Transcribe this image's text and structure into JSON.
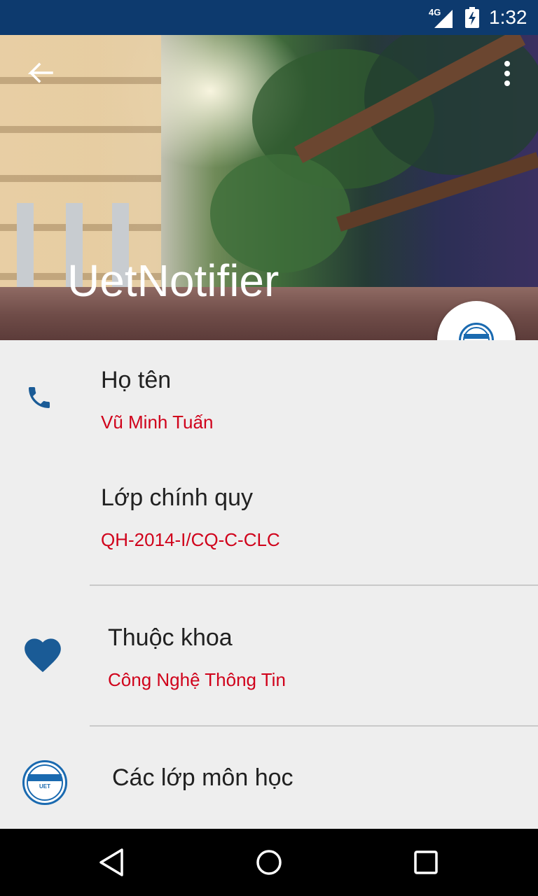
{
  "status_bar": {
    "network": "4G",
    "time": "1:32",
    "signal_icon": "cell-signal-icon",
    "battery_icon": "battery-charging-icon"
  },
  "header": {
    "title": "UetNotifier",
    "back_icon": "back-arrow-icon",
    "menu_icon": "more-vert-icon"
  },
  "fab": {
    "icon": "uet-logo-icon"
  },
  "profile": {
    "name": {
      "label": "Họ tên",
      "value": "Vũ Minh Tuấn",
      "icon": "phone-icon"
    },
    "class": {
      "label": "Lớp chính quy",
      "value": "QH-2014-I/CQ-C-CLC"
    },
    "faculty": {
      "label": "Thuộc khoa",
      "value": "Công Nghệ Thông Tin",
      "icon": "heart-icon"
    },
    "courses": {
      "label": "Các lớp môn học",
      "icon": "uet-logo-icon"
    }
  },
  "nav_bar": {
    "back": "nav-back-icon",
    "home": "nav-home-icon",
    "recents": "nav-recents-icon"
  },
  "colors": {
    "primary_dark": "#0d3a6e",
    "accent_icon": "#1a5b96",
    "value_text": "#d0021b"
  }
}
